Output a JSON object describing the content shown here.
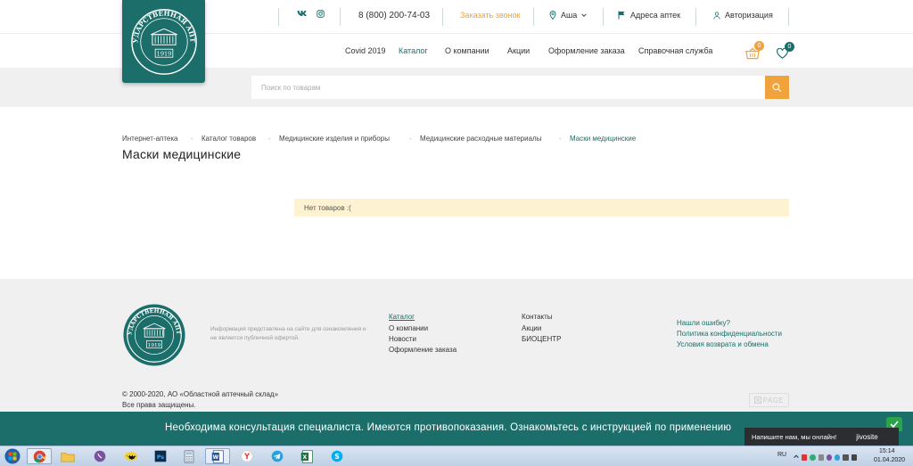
{
  "topbar": {
    "vk_label": "вк",
    "phone": "8 (800) 200-74-03",
    "callback": "Заказать звонок",
    "city": "Аша",
    "pharmacies": "Адреса аптек",
    "login": "Авторизация"
  },
  "logo": {
    "text": "Государственная аптека",
    "year": "1919"
  },
  "nav": {
    "items": [
      "Covid 2019",
      "Каталог",
      "О компании",
      "Акции",
      "Оформление заказа",
      "Справочная служба"
    ],
    "active_index": 1,
    "cart_count": "0",
    "fav_count": "0"
  },
  "search": {
    "placeholder": "Поиск по товарам"
  },
  "breadcrumb": {
    "items": [
      "Интернет-аптека",
      "Каталог товаров",
      "Медицинские изделия и приборы",
      "Медицинские расходные материалы",
      "Маски медицинские"
    ],
    "separator": "-"
  },
  "main": {
    "title": "Маски медицинские",
    "empty_notice": "Нет товаров :("
  },
  "footer": {
    "info": "Информация представлена на сайте для ознакомления и не является публичной офертой.",
    "col1": [
      "Каталог",
      "О компании",
      "Новости",
      "Оформление заказа"
    ],
    "col2": [
      "Контакты",
      "Акции",
      "БИОЦЕНТР"
    ],
    "col3": [
      "Нашли ошибку?",
      "Политика конфиденциальности",
      "Условия возврата и обмена"
    ],
    "copyright": "© 2000-2020, АО «Областной аптечный склад»",
    "rights": "Все права защищены.",
    "badge": "PAGE"
  },
  "disclaimer": {
    "text": "Необходима консультация специалиста. Имеются противопоказания. Ознакомьтесь с инструкцией по применению"
  },
  "jivo": {
    "message": "Напишите нам, мы онлайн!",
    "brand": "jivosite"
  },
  "taskbar": {
    "lang": "RU",
    "time": "15:14",
    "date": "01.04.2020"
  },
  "colors": {
    "brand": "#1b6e6a",
    "accent": "#f0a33a",
    "notice_bg": "#fdf3d2"
  }
}
